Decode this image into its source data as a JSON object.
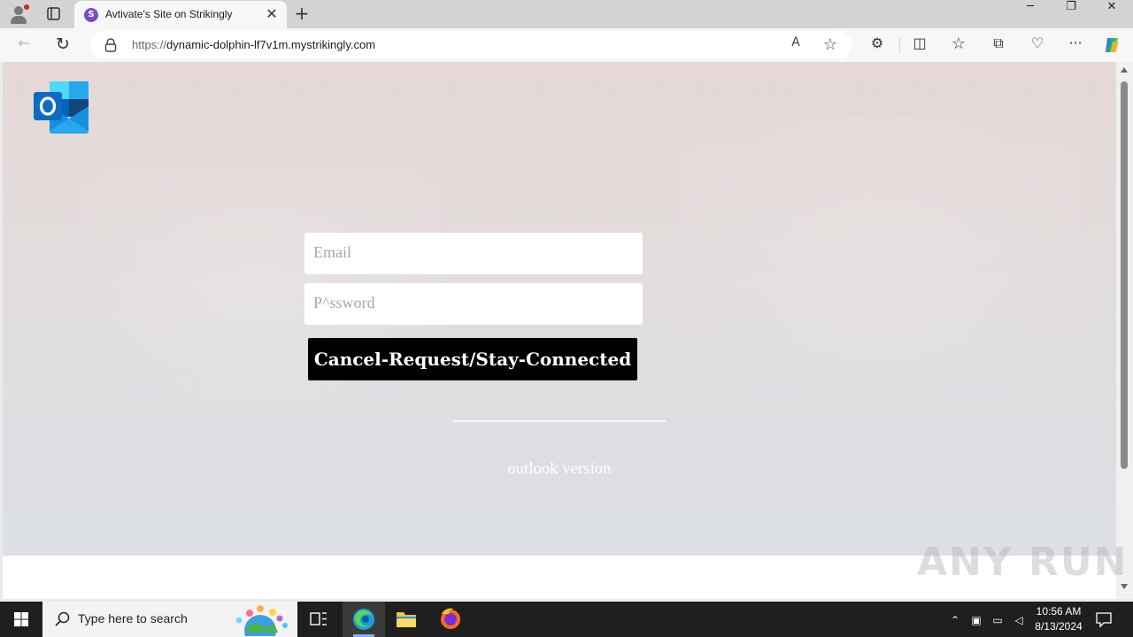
{
  "browser": {
    "tab": {
      "favicon_letter": "S",
      "title": "Avtivate's Site on Strikingly",
      "close_glyph": "✕"
    },
    "new_tab_glyph": "+",
    "window_controls": {
      "minimize": "─",
      "restore": "❐",
      "close": "✕"
    },
    "nav": {
      "back": "←",
      "reload": "↻"
    },
    "address": {
      "scheme": "https://",
      "host": "dynamic-dolphin-lf7v1m.mystrikingly.com"
    },
    "address_icons": {
      "read_aloud": "A",
      "favorite": "☆"
    },
    "toolbar_icons": {
      "extensions": "⚙",
      "split": "◫",
      "favorites": "☆",
      "collections": "⧉",
      "performance": "♡",
      "more": "···"
    }
  },
  "page": {
    "email_placeholder": "Email",
    "password_placeholder": "P^ssword",
    "cta_label": "Cancel-Request/Stay-Connected",
    "version_text": "outlook version"
  },
  "watermark": "ANY RUN",
  "taskbar": {
    "search_placeholder": "Type here to search",
    "time": "10:56 AM",
    "date": "8/13/2024"
  },
  "colors": {
    "cta_background": "#000000",
    "outlook_blue": "#0f6cbd",
    "edge_blue": "#1c9dd9",
    "taskbar": "#1f1f1f"
  }
}
